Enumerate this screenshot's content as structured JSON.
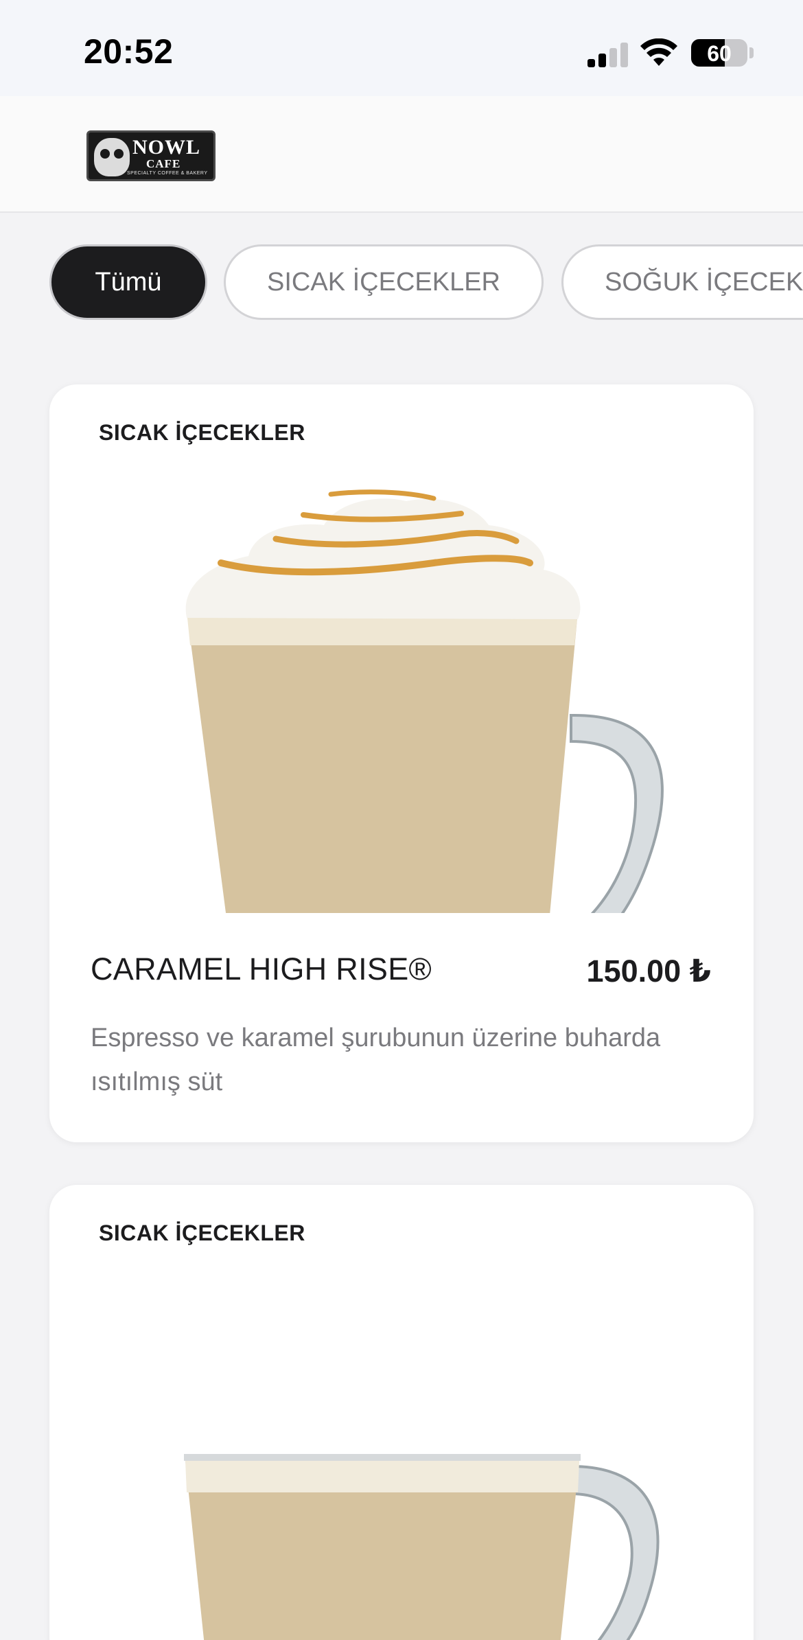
{
  "status_bar": {
    "time": "20:52",
    "battery": "60"
  },
  "header": {
    "logo_title": "NOWL",
    "logo_subtitle": "CAFE",
    "logo_tagline": "SPECIALTY COFFEE & BAKERY"
  },
  "categories": [
    {
      "label": "Tümü",
      "active": true
    },
    {
      "label": "SICAK İÇECEKLER",
      "active": false
    },
    {
      "label": "SOĞUK İÇECEKLER",
      "active": false
    }
  ],
  "products": [
    {
      "category": "SICAK İÇECEKLER",
      "name": "CARAMEL HIGH RISE®",
      "price": "150.00 ₺",
      "description": "Espresso ve karamel şurubunun üzerine buharda ısıtılmış süt",
      "image": "caramel-latte-with-whipped-cream-image"
    },
    {
      "category": "SICAK İÇECEKLER",
      "image": "latte-glass-mug-image"
    }
  ],
  "colors": {
    "active_chip": "#1c1c1e",
    "background": "#f3f3f5",
    "card": "#ffffff",
    "muted_text": "#7a7a7e"
  }
}
